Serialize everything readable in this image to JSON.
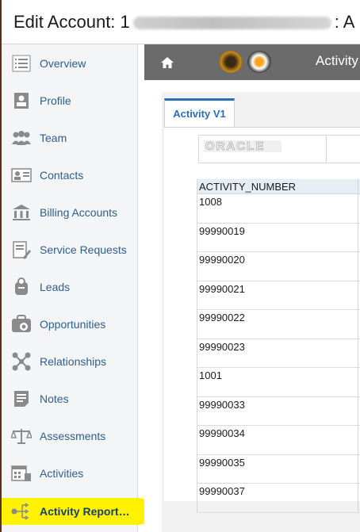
{
  "window": {
    "title_prefix": "Edit Account: 1",
    "title_suffix": ": A"
  },
  "sidebar": {
    "items": [
      {
        "label": "Overview",
        "icon": "overview-list-icon"
      },
      {
        "label": "Profile",
        "icon": "profile-badge-icon"
      },
      {
        "label": "Team",
        "icon": "team-people-icon"
      },
      {
        "label": "Contacts",
        "icon": "contacts-card-icon"
      },
      {
        "label": "Billing Accounts",
        "icon": "bank-building-icon"
      },
      {
        "label": "Service Requests",
        "icon": "service-request-icon"
      },
      {
        "label": "Leads",
        "icon": "leads-icon"
      },
      {
        "label": "Opportunities",
        "icon": "opportunities-icon"
      },
      {
        "label": "Relationships",
        "icon": "relationships-network-icon"
      },
      {
        "label": "Notes",
        "icon": "notes-icon"
      },
      {
        "label": "Assessments",
        "icon": "scales-icon"
      },
      {
        "label": "Activities",
        "icon": "calendar-icon"
      },
      {
        "label": "Activity Report…",
        "icon": "activity-report-icon",
        "active": true
      }
    ]
  },
  "navbar": {
    "title": "Activity",
    "home_icon": "home-icon"
  },
  "tab": {
    "label": "Activity V1"
  },
  "report": {
    "logo_text": "ORACLE",
    "column_header": "ACTIVITY_NUMBER",
    "rows": [
      "1008",
      "99990019",
      "99990020",
      "99990021",
      "99990022",
      "99990023",
      "1001",
      "99990033",
      "99990034",
      "99990035",
      "99990037"
    ]
  },
  "colors": {
    "highlight": "#fff200",
    "nav_bar": "#6b6b6b",
    "link": "#2e5e8e",
    "tab_accent": "#2a6fb6"
  }
}
